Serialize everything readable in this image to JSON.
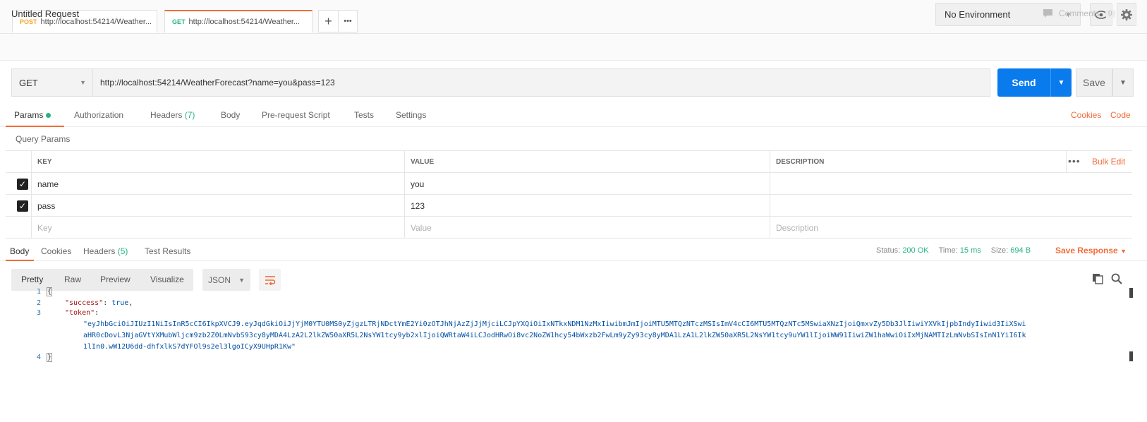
{
  "request_tabs": [
    {
      "method": "POST",
      "title": "http://localhost:54214/Weather..."
    },
    {
      "method": "GET",
      "title": "http://localhost:54214/Weather..."
    }
  ],
  "add_tab_label": "+",
  "more_tabs_label": "•••",
  "environment": {
    "selected": "No Environment"
  },
  "request": {
    "title": "Untitled Request",
    "comments_label": "Comments",
    "comments_count": "0",
    "method": "GET",
    "url": "http://localhost:54214/WeatherForecast?name=you&pass=123",
    "send_label": "Send",
    "save_label": "Save"
  },
  "request_sections": {
    "params": "Params",
    "authorization": "Authorization",
    "headers": "Headers",
    "headers_count": "(7)",
    "body": "Body",
    "prerequest": "Pre-request Script",
    "tests": "Tests",
    "settings": "Settings",
    "cookies": "Cookies",
    "code": "Code"
  },
  "query_params": {
    "label": "Query Params",
    "columns": [
      "KEY",
      "VALUE",
      "DESCRIPTION"
    ],
    "bulk_edit": "Bulk Edit",
    "more": "•••",
    "rows": [
      {
        "key": "name",
        "value": "you",
        "description": "",
        "checked": true
      },
      {
        "key": "pass",
        "value": "123",
        "description": "",
        "checked": true
      }
    ],
    "placeholders": {
      "key": "Key",
      "value": "Value",
      "description": "Description"
    }
  },
  "response": {
    "tabs": {
      "body": "Body",
      "cookies": "Cookies",
      "headers": "Headers",
      "headers_count": "(5)",
      "test_results": "Test Results"
    },
    "status_label": "Status:",
    "status_value": "200 OK",
    "time_label": "Time:",
    "time_value": "15 ms",
    "size_label": "Size:",
    "size_value": "694 B",
    "save_response": "Save Response",
    "view_modes": [
      "Pretty",
      "Raw",
      "Preview",
      "Visualize"
    ],
    "format": "JSON",
    "code_lines": {
      "ln1": "1",
      "ln2": "2",
      "ln3": "3",
      "ln4": "4",
      "open_brace": "{",
      "success_key": "\"success\"",
      "success_val": "true",
      "token_key": "\"token\"",
      "token_val_1": "\"eyJhbGciOiJIUzI1NiIsInR5cCI6IkpXVCJ9.eyJqdGkiOiJjYjM0YTU0MS0yZjgzLTRjNDctYmE2Yi0zOTJhNjAzZjJjMjciLCJpYXQiOiIxNTkxNDM1NzMxIiwibmJmIjoiMTU5MTQzNTczMSIsImV4cCI6MTU5MTQzNTc5MSwiaXNzIjoiQmxvZy5Db3JlIiwiYXVkIjpbIndyIiwid3IiXSwi",
      "token_val_2": "aHR0cDovL3NjaGVtYXMubWljcm9zb2Z0LmNvbS93cy8yMDA4LzA2L2lkZW50aXR5L2NsYW1tcy9yb2xlIjoiQWRtaW4iLCJodHRwOi8vc2NoZW1hcy54bWxzb2FwLm9yZy93cy8yMDA1LzA1L2lkZW50aXR5L2NsYW1tcy9uYW1lIjoiWW91IiwiZW1haWwiOiIxMjNAMTIzLmNvbSIsInN1YiI6Ik",
      "token_val_3": "1lIn0.wW12U6dd-dhfxlkS7dYFOl9s2el3lgoICyX9UHpR1Kw\"",
      "close_brace": "}"
    }
  }
}
